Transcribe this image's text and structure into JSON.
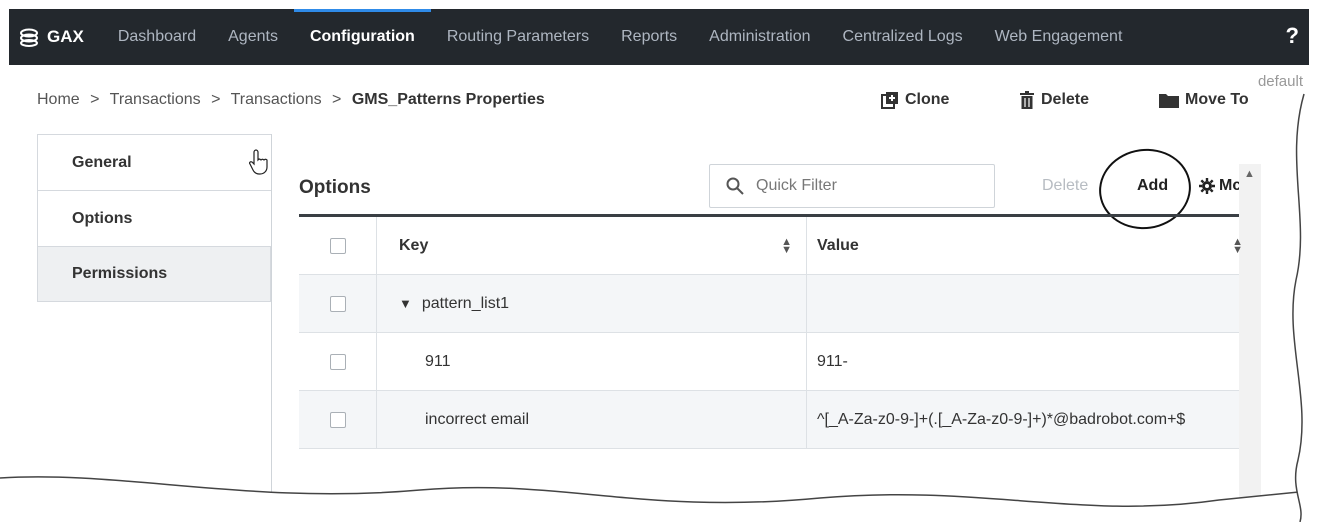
{
  "app": {
    "brand": "GAX",
    "help": "?",
    "tenant": "default"
  },
  "nav": {
    "items": [
      {
        "label": "Dashboard"
      },
      {
        "label": "Agents"
      },
      {
        "label": "Configuration"
      },
      {
        "label": "Routing Parameters"
      },
      {
        "label": "Reports"
      },
      {
        "label": "Administration"
      },
      {
        "label": "Centralized Logs"
      },
      {
        "label": "Web Engagement"
      }
    ]
  },
  "breadcrumb": {
    "items": [
      "Home",
      "Transactions",
      "Transactions"
    ],
    "current": "GMS_Patterns Properties",
    "separator": ">"
  },
  "actions": {
    "clone": "Clone",
    "delete": "Delete",
    "move_to": "Move To"
  },
  "side_tabs": [
    {
      "label": "General"
    },
    {
      "label": "Options"
    },
    {
      "label": "Permissions"
    }
  ],
  "options": {
    "title": "Options",
    "filter_placeholder": "Quick Filter",
    "delete": "Delete",
    "add": "Add",
    "more": "Mc"
  },
  "table": {
    "columns": {
      "key": "Key",
      "value": "Value"
    },
    "rows": [
      {
        "key": "pattern_list1",
        "value": "",
        "group": true
      },
      {
        "key": "911",
        "value": "911-"
      },
      {
        "key": "incorrect email",
        "value": "^[_A-Za-z0-9-]+(.[_A-Za-z0-9-]+)*@badrobot.com+$"
      }
    ]
  },
  "colors": {
    "nav_bg": "#23282d",
    "nav_active_bar": "#2f8be8"
  }
}
